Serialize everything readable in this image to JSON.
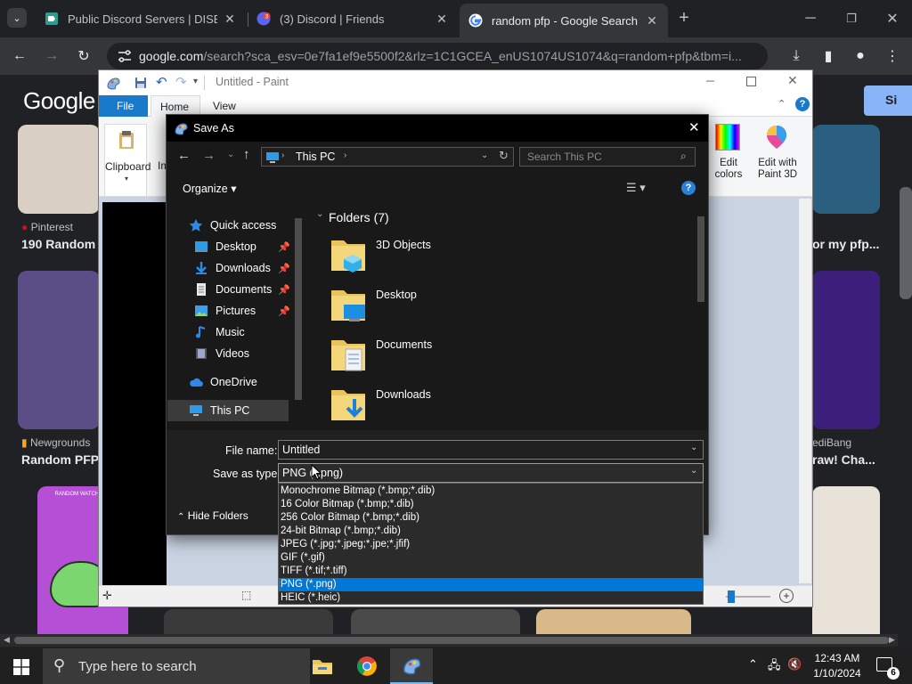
{
  "browser": {
    "tabs": [
      {
        "title": "Public Discord Servers | DISBOA",
        "active": false
      },
      {
        "title": "(3) Discord | Friends",
        "active": false
      },
      {
        "title": "random pfp - Google Search",
        "active": true
      }
    ],
    "new_tab_glyph": "+",
    "url_host": "google.com",
    "url_rest": "/search?sca_esv=0e7fa1ef9e5500f2&rlz=1C1GCEA_enUS1074US1074&q=random+pfp&tbm=i...",
    "favicon_badge": "3"
  },
  "google": {
    "logo": "Google",
    "signin_partial": "Si",
    "results": [
      {
        "source": "Pinterest",
        "title": "190 Random"
      },
      {
        "source": "",
        "title": "or my pfp..."
      },
      {
        "source": "Newgrounds",
        "title": "Random PFP"
      },
      {
        "source": "ediBang",
        "title": "raw! Cha..."
      }
    ],
    "img_caption": "RANDOM WATCH PFP"
  },
  "paint": {
    "title": "Untitled - Paint",
    "ribbon_tabs": [
      "File",
      "Home",
      "View"
    ],
    "clipboard_label": "Clipboard",
    "image_label_partial": "Im",
    "edit_colors_label": "Edit colors",
    "edit_paint3d_label": "Edit with Paint 3D",
    "help_glyph": "?"
  },
  "save_as": {
    "title": "Save As",
    "breadcrumb": "This PC",
    "search_placeholder": "Search This PC",
    "organize_label": "Organize",
    "nav_items": [
      {
        "label": "Quick access",
        "icon": "star-icon",
        "pinned": false
      },
      {
        "label": "Desktop",
        "icon": "desktop-icon",
        "pinned": true
      },
      {
        "label": "Downloads",
        "icon": "download-icon",
        "pinned": true
      },
      {
        "label": "Documents",
        "icon": "document-icon",
        "pinned": true
      },
      {
        "label": "Pictures",
        "icon": "picture-icon",
        "pinned": true
      },
      {
        "label": "Music",
        "icon": "music-icon",
        "pinned": false
      },
      {
        "label": "Videos",
        "icon": "video-icon",
        "pinned": false
      },
      {
        "label": "OneDrive",
        "icon": "cloud-icon",
        "pinned": false
      },
      {
        "label": "This PC",
        "icon": "pc-icon",
        "pinned": false,
        "selected": true
      }
    ],
    "folders_header": "Folders (7)",
    "folders": [
      "3D Objects",
      "Desktop",
      "Documents",
      "Downloads"
    ],
    "file_name_label": "File name:",
    "file_name_value": "Untitled",
    "save_type_label": "Save as type:",
    "save_type_value": "PNG (*.png)",
    "hide_folders_label": "Hide Folders",
    "type_options": [
      "Monochrome Bitmap (*.bmp;*.dib)",
      "16 Color Bitmap (*.bmp;*.dib)",
      "256 Color Bitmap (*.bmp;*.dib)",
      "24-bit Bitmap (*.bmp;*.dib)",
      "JPEG (*.jpg;*.jpeg;*.jpe;*.jfif)",
      "GIF (*.gif)",
      "TIFF (*.tif;*.tiff)",
      "PNG (*.png)",
      "HEIC (*.heic)"
    ],
    "selected_type_index": 7
  },
  "taskbar": {
    "search_placeholder": "Type here to search",
    "time": "12:43 AM",
    "date": "1/10/2024",
    "notification_count": "6"
  },
  "colors": {
    "accent": "#0078d7",
    "chrome_dark": "#202124",
    "dialog_dark": "#191919"
  }
}
